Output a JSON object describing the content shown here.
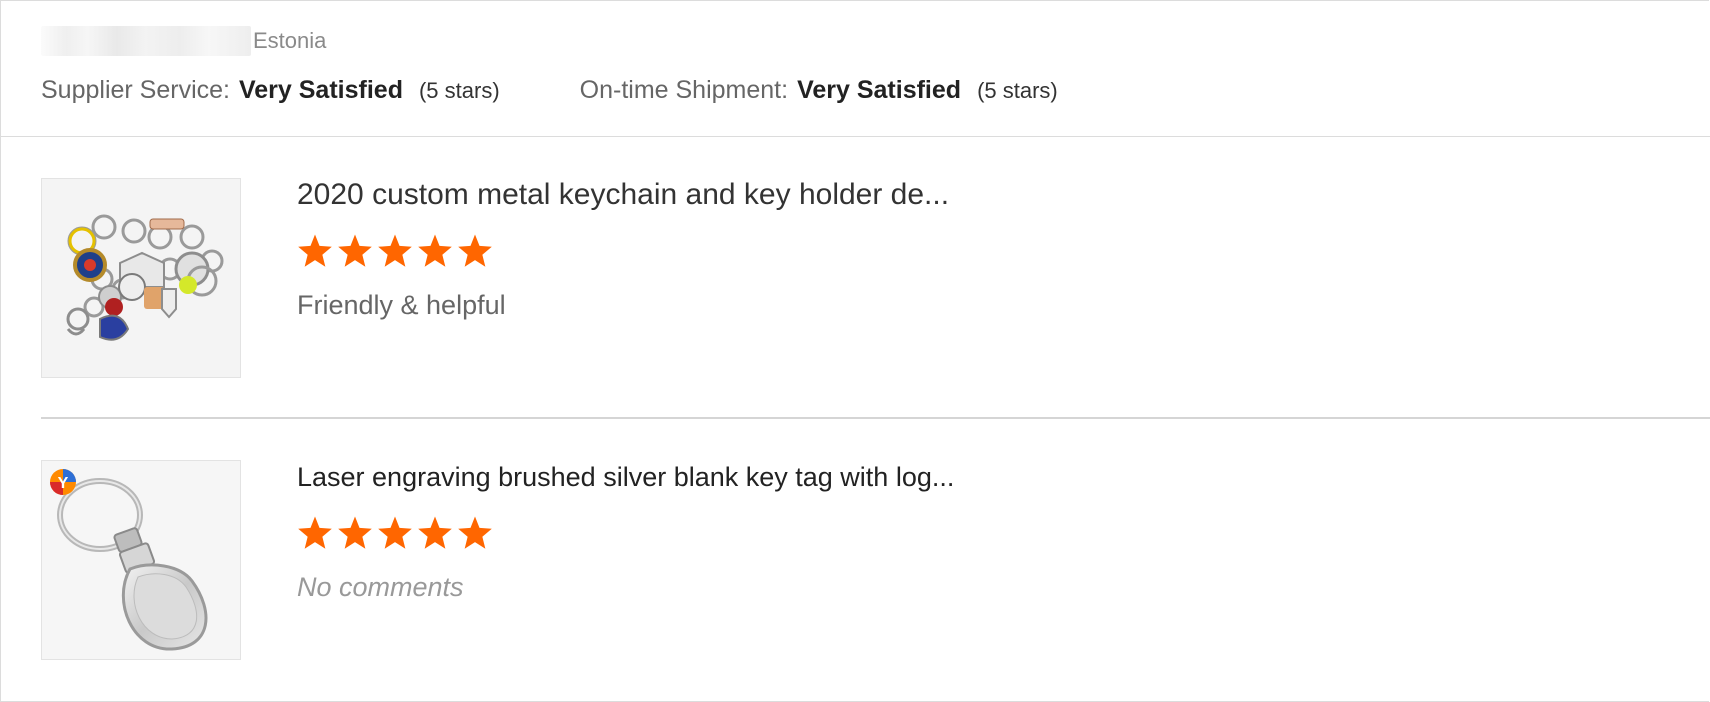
{
  "buyer": {
    "country": "Estonia"
  },
  "overall": [
    {
      "label": "Supplier Service:",
      "value": "Very Satisfied",
      "stars_text": "(5 stars)"
    },
    {
      "label": "On-time Shipment:",
      "value": "Very Satisfied",
      "stars_text": "(5 stars)"
    }
  ],
  "reviews": [
    {
      "title": "2020 custom metal keychain and key holder de...",
      "rating": 5,
      "comment": "Friendly & helpful",
      "thumbnail": "keychain-collection-image"
    },
    {
      "title": "Laser engraving brushed silver blank key tag with log...",
      "rating": 5,
      "comment": "No comments",
      "thumbnail": "silver-key-tag-image"
    }
  ],
  "colors": {
    "star": "#ff6600",
    "border": "#dcdcdc"
  },
  "icons": {
    "star": "star-icon",
    "badge": "y-badge-icon"
  }
}
